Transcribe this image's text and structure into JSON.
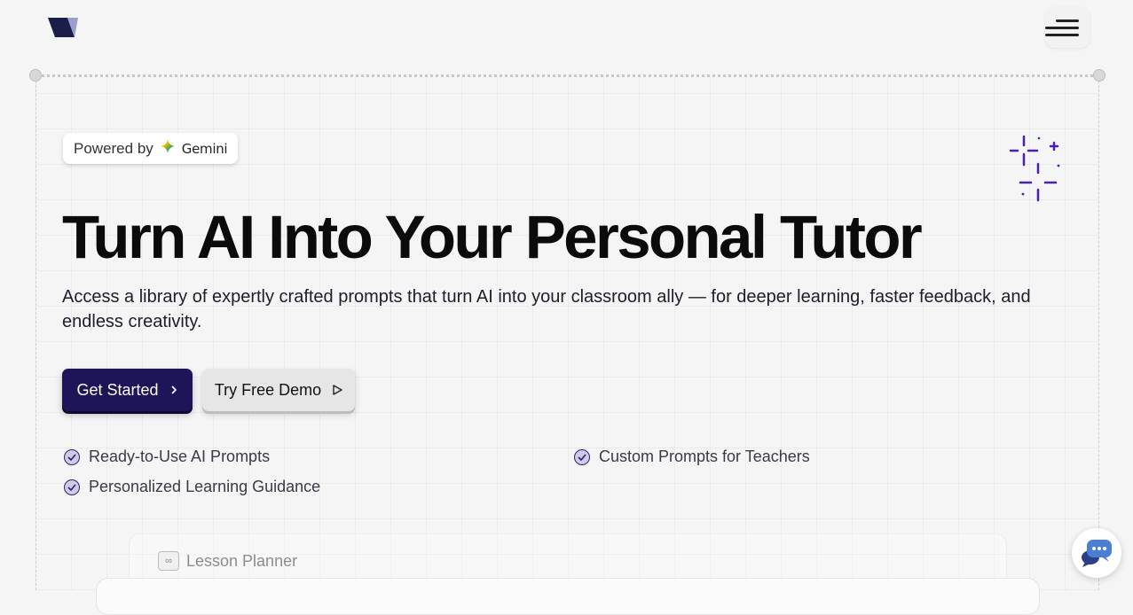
{
  "header": {
    "logo_icon": "brand-logo-icon",
    "menu_icon": "hamburger-menu-icon"
  },
  "badge": {
    "prefix": "Powered by",
    "brand": "Gemini",
    "brand_icon": "gemini-star-icon"
  },
  "hero": {
    "title": "Turn AI Into Your Personal Tutor",
    "subtitle": "Access a library of expertly crafted prompts that turn AI into your classroom ally — for deeper learning, faster feedback, and endless creativity."
  },
  "actions": {
    "primary_label": "Get Started",
    "secondary_label": "Try Free Demo"
  },
  "features": [
    "Ready-to-Use AI Prompts",
    "Custom Prompts for Teachers",
    "Personalized Learning Guidance"
  ],
  "preview": {
    "tab_label": "Lesson Planner"
  },
  "colors": {
    "primary": "#1e1458",
    "accent": "#4a1fb8",
    "background": "#f5f5f5"
  },
  "chat": {
    "icon": "chat-bubble-icon"
  }
}
